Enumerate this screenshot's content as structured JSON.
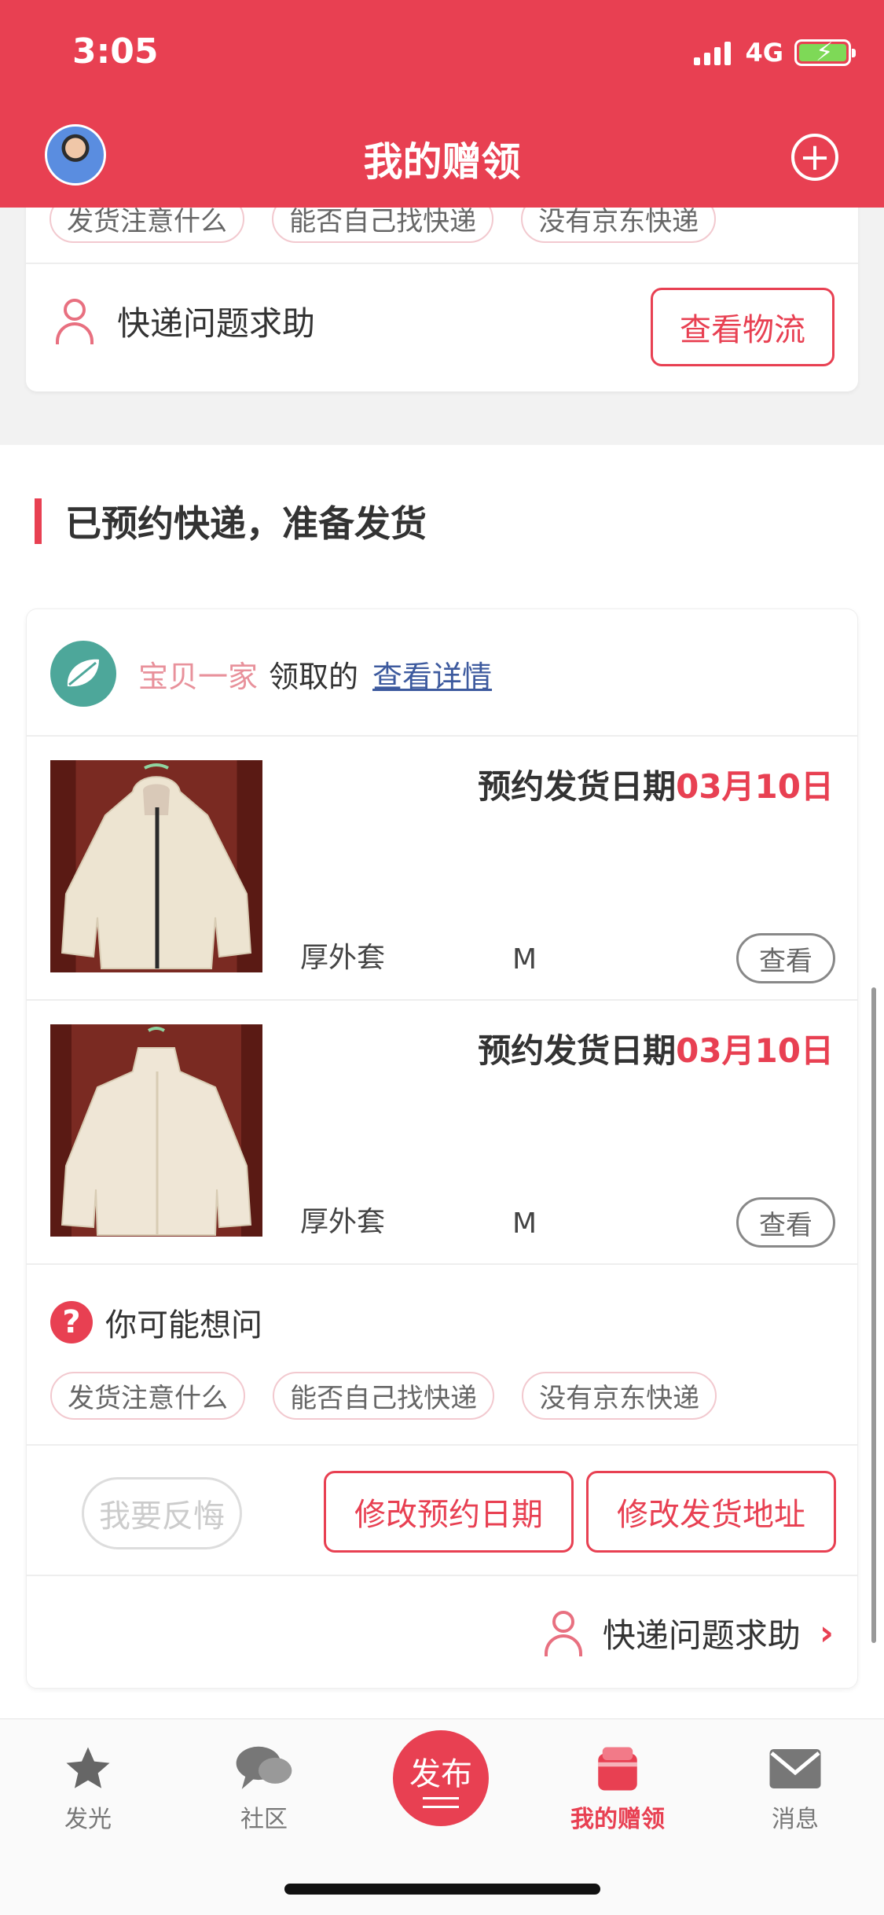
{
  "status": {
    "time": "3:05",
    "network": "4G"
  },
  "header": {
    "title": "我的赠领"
  },
  "top_card": {
    "chips": [
      "发货注意什么",
      "能否自己找快递",
      "没有京东快递"
    ],
    "help_label": "快递问题求助",
    "logistics_button": "查看物流"
  },
  "section": {
    "title": "已预约快递，准备发货"
  },
  "order": {
    "receiver": "宝贝一家",
    "received_text": "领取的",
    "detail_link": "查看详情",
    "items": [
      {
        "date_label": "预约发货日期",
        "date_value": "03月10日",
        "name": "厚外套",
        "size": "M",
        "view_label": "查看"
      },
      {
        "date_label": "预约发货日期",
        "date_value": "03月10日",
        "name": "厚外套",
        "size": "M",
        "view_label": "查看"
      }
    ],
    "faq_title": "你可能想问",
    "faq_chips": [
      "发货注意什么",
      "能否自己找快递",
      "没有京东快递"
    ],
    "regret_button": "我要反悔",
    "modify_date_button": "修改预约日期",
    "modify_address_button": "修改发货地址",
    "help_label": "快递问题求助"
  },
  "tabbar": {
    "tabs": [
      {
        "label": "发光",
        "icon": "star-icon"
      },
      {
        "label": "社区",
        "icon": "chat-icon"
      },
      {
        "label": "发布",
        "icon": "publish-icon"
      },
      {
        "label": "我的赠领",
        "icon": "gift-box-icon"
      },
      {
        "label": "消息",
        "icon": "mail-icon"
      }
    ],
    "active_index": 3
  },
  "colors": {
    "brand": "#e84052",
    "receiver": "#e8919b",
    "link": "#3d5a9e"
  }
}
